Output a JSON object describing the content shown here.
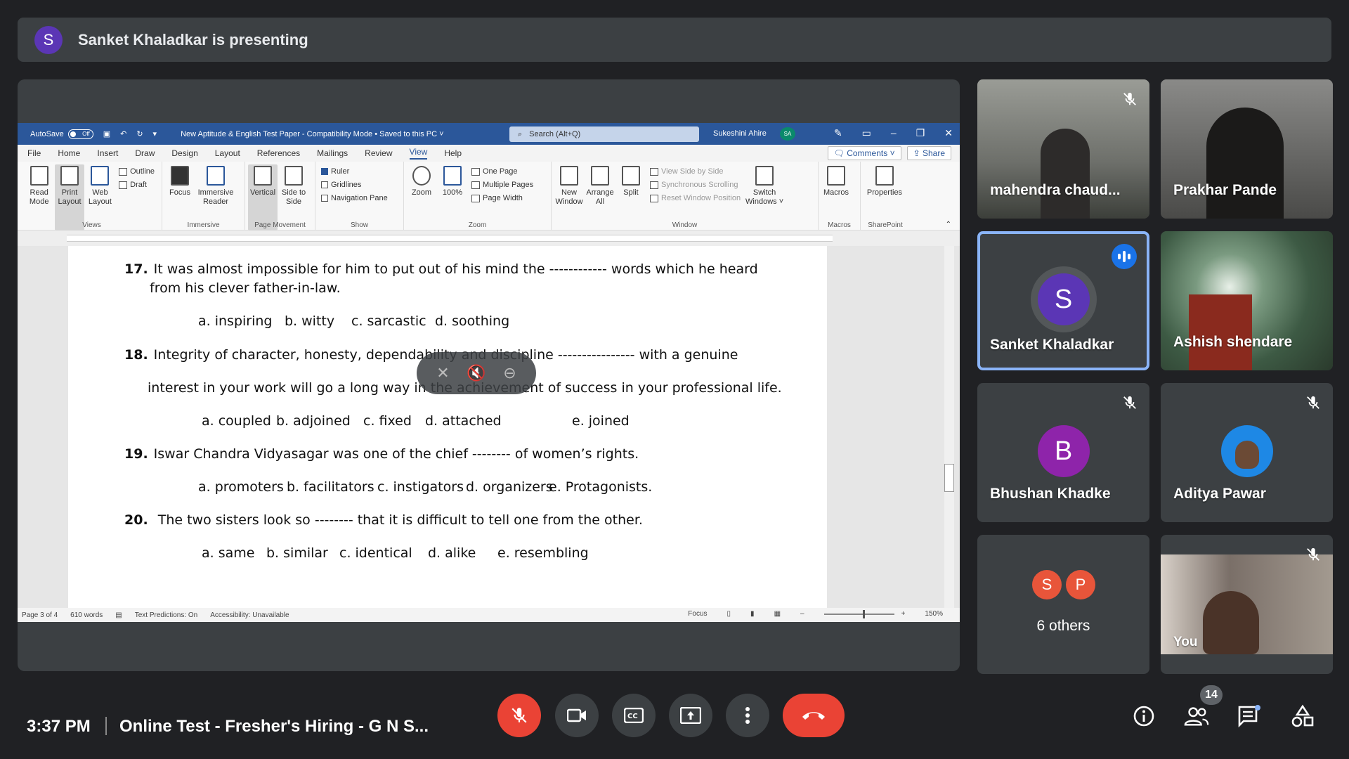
{
  "banner": {
    "avatar_letter": "S",
    "text": "Sanket Khaladkar is presenting"
  },
  "word": {
    "autosave_label": "AutoSave",
    "autosave_state": "Off",
    "doc_title": "New Aptitude & English Test Paper  -  Compatibility Mode • Saved to this PC  ˅",
    "search_placeholder": "Search (Alt+Q)",
    "user_name": "Sukeshini Ahire",
    "user_initials": "SA",
    "menu": [
      "File",
      "Home",
      "Insert",
      "Draw",
      "Design",
      "Layout",
      "References",
      "Mailings",
      "Review",
      "View",
      "Help"
    ],
    "active_menu": "View",
    "comments_label": "Comments",
    "share_label": "Share",
    "ribbon": {
      "views": {
        "label": "Views",
        "read_mode": "Read Mode",
        "print_layout": "Print Layout",
        "web_layout": "Web Layout",
        "outline": "Outline",
        "draft": "Draft"
      },
      "immersive": {
        "label": "Immersive",
        "focus": "Focus",
        "immersive_reader": "Immersive Reader"
      },
      "page_movement": {
        "label": "Page Movement",
        "vertical": "Vertical",
        "side_to_side": "Side to Side"
      },
      "show": {
        "label": "Show",
        "ruler": "Ruler",
        "gridlines": "Gridlines",
        "navigation_pane": "Navigation Pane"
      },
      "zoom": {
        "label": "Zoom",
        "zoom": "Zoom",
        "hundred": "100%",
        "one_page": "One Page",
        "multiple_pages": "Multiple Pages",
        "page_width": "Page Width"
      },
      "window": {
        "label": "Window",
        "new_window": "New Window",
        "arrange_all": "Arrange All",
        "split": "Split",
        "view_side_by_side": "View Side by Side",
        "sync_scrolling": "Synchronous Scrolling",
        "reset_window": "Reset Window Position",
        "switch_windows": "Switch Windows ˅"
      },
      "macros": {
        "label": "Macros",
        "macros": "Macros"
      },
      "sharepoint": {
        "label": "SharePoint",
        "properties": "Properties"
      }
    },
    "questions": [
      {
        "num": "17.",
        "line1": "It was almost impossible for him to put out of his mind the ------------ words which he heard",
        "line2": "from his clever father-in-law.",
        "options": [
          "a. inspiring",
          "b. witty",
          "c. sarcastic",
          "d. soothing"
        ]
      },
      {
        "num": "18.",
        "line1": "Integrity of character, honesty, dependability and discipline ---------------- with a genuine",
        "line2": "interest in your work will go a long way in the achievement of success in your professional life.",
        "options": [
          "a. coupled",
          "b. adjoined",
          "c. fixed",
          "d. attached",
          "e. joined"
        ]
      },
      {
        "num": "19.",
        "line1": "Iswar Chandra Vidyasagar was one of the chief -------- of women’s rights.",
        "options": [
          "a. promoters",
          "b. facilitators",
          "c. instigators",
          "d. organizers",
          "e. Protagonists."
        ]
      },
      {
        "num": "20.",
        "line1": " The two sisters look so -------- that it is difficult to tell one from the other.",
        "options": [
          "a. same",
          "b. similar",
          "c. identical",
          "d. alike",
          "e. resembling"
        ]
      }
    ],
    "status": {
      "page": "Page 3 of 4",
      "words": "610 words",
      "predictions": "Text Predictions: On",
      "accessibility": "Accessibility: Unavailable",
      "focus": "Focus",
      "zoom": "150%"
    }
  },
  "tiles": [
    {
      "name": "mahendra chaud...",
      "muted": true,
      "type": "camera",
      "bg": "#6d6f6a"
    },
    {
      "name": "Prakhar Pande",
      "muted": false,
      "type": "camera",
      "bg": "#4a4a48"
    },
    {
      "name": "Sanket Khaladkar",
      "letter": "S",
      "color": "#5b36b5",
      "speaking": true,
      "type": "avatar"
    },
    {
      "name": "Ashish shendare",
      "muted": false,
      "type": "camera",
      "bg": "#3d5a44"
    },
    {
      "name": "Bhushan Khadke",
      "letter": "B",
      "color": "#8e24aa",
      "muted": true,
      "type": "avatar"
    },
    {
      "name": "Aditya Pawar",
      "muted": true,
      "type": "photo",
      "color": "#1e88e5"
    },
    {
      "others_label": "6 others",
      "letters": [
        "S",
        "P"
      ],
      "colors": [
        "#e8553a",
        "#e8553a"
      ],
      "type": "others"
    },
    {
      "name": "You",
      "muted": true,
      "type": "camera",
      "bg": "#7a6f68"
    }
  ],
  "bottom": {
    "time": "3:37 PM",
    "meeting_name": "Online Test - Fresher's Hiring - G N S...",
    "participant_count": "14"
  }
}
